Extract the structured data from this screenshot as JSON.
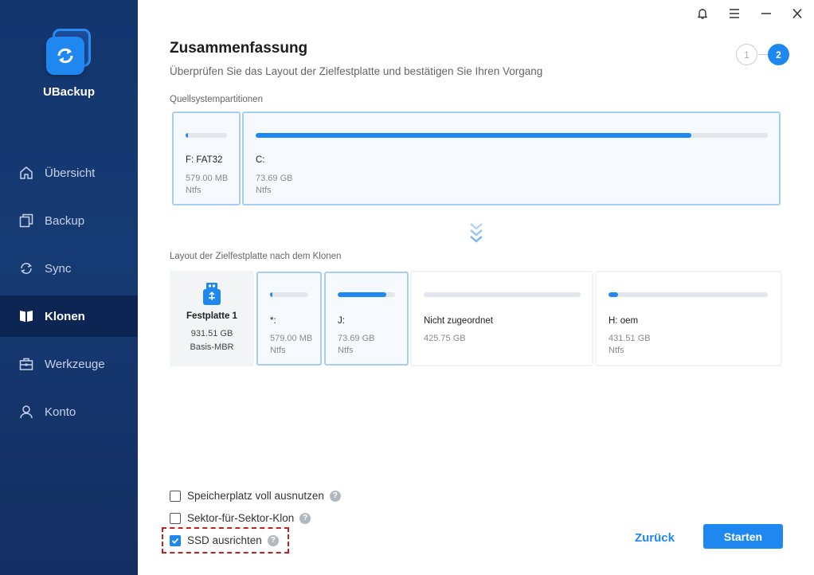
{
  "app": {
    "name": "UBackup"
  },
  "sidebar": {
    "items": [
      {
        "label": "Übersicht",
        "icon": "home-icon",
        "active": false
      },
      {
        "label": "Backup",
        "icon": "backup-icon",
        "active": false
      },
      {
        "label": "Sync",
        "icon": "sync-icon",
        "active": false
      },
      {
        "label": "Klonen",
        "icon": "clone-icon",
        "active": true
      },
      {
        "label": "Werkzeuge",
        "icon": "toolbox-icon",
        "active": false
      },
      {
        "label": "Konto",
        "icon": "user-icon",
        "active": false
      }
    ]
  },
  "titlebar": {
    "icons": [
      "bell-icon",
      "menu-icon",
      "minimize-icon",
      "close-icon"
    ]
  },
  "header": {
    "title": "Zusammenfassung",
    "subtitle": "Überprüfen Sie das Layout der Zielfestplatte und bestätigen Sie Ihren Vorgang",
    "steps": [
      "1",
      "2"
    ],
    "current_step": 2
  },
  "source": {
    "label": "Quellsystempartitionen",
    "partitions": [
      {
        "name": "F: FAT32",
        "size": "579.00 MB",
        "fs": "Ntfs",
        "used_fraction": 0.05
      },
      {
        "name": "C:",
        "size": "73.69 GB",
        "fs": "Ntfs",
        "used_fraction": 0.85
      }
    ]
  },
  "target": {
    "label": "Layout der Zielfestplatte nach dem Klonen",
    "disk": {
      "name": "Festplatte 1",
      "size": "931.51 GB",
      "type": "Basis-MBR"
    },
    "partitions": [
      {
        "name": "*:",
        "size": "579.00 MB",
        "fs": "Ntfs",
        "used_fraction": 0.05
      },
      {
        "name": "J:",
        "size": "73.69 GB",
        "fs": "Ntfs",
        "used_fraction": 0.85
      },
      {
        "name": "Nicht zugeordnet",
        "size": "425.75 GB",
        "fs": "",
        "used_fraction": 0
      },
      {
        "name": "H: oem",
        "size": "431.51 GB",
        "fs": "Ntfs",
        "used_fraction": 0.02
      }
    ]
  },
  "options": [
    {
      "label": "Speicherplatz voll ausnutzen",
      "checked": false
    },
    {
      "label": "Sektor-für-Sektor-Klon",
      "checked": false
    },
    {
      "label": "SSD ausrichten",
      "checked": true
    }
  ],
  "buttons": {
    "back": "Zurück",
    "start": "Starten"
  },
  "colors": {
    "accent": "#1e88f0",
    "sidebar": "#163a73",
    "highlight": "#c81e1e"
  }
}
